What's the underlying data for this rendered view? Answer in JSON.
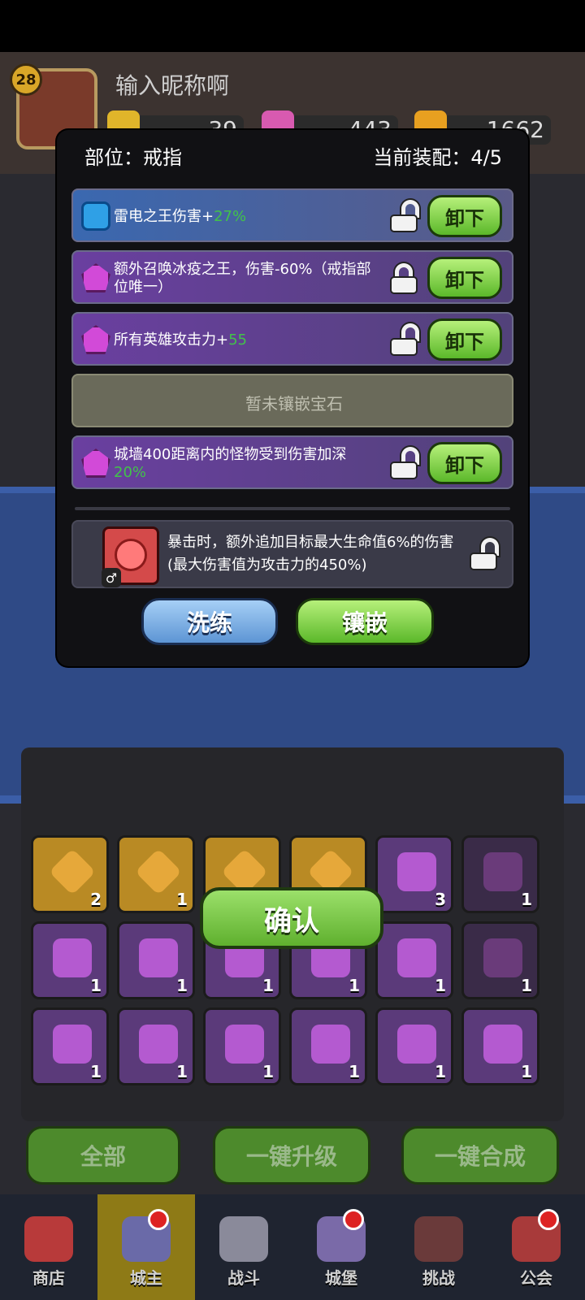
{
  "player": {
    "level": "28",
    "nickname": "输入昵称啊"
  },
  "resources": {
    "res1": "39",
    "res2": "443",
    "res3": "1662"
  },
  "panel": {
    "slot_label": "部位：戒指",
    "equip_label": "当前装配：4/5",
    "rows": [
      {
        "text_main": "雷电之王伤害+",
        "text_hl": "27%",
        "text_after": "",
        "gem": "blue-hex-gem-icon",
        "lock": "unlocked",
        "button": "卸下"
      },
      {
        "text_main": "额外召唤冰疫之王，伤害-60%（戒指部位唯一）",
        "text_hl": "",
        "text_after": "",
        "gem": "purple-pentagon-gem-icon",
        "lock": "locked",
        "button": "卸下"
      },
      {
        "text_main": "所有英雄攻击力+",
        "text_hl": "55",
        "text_after": "",
        "gem": "purple-pentagon-gem-icon",
        "lock": "unlocked",
        "button": "卸下"
      },
      {
        "empty_text": "暂未镶嵌宝石"
      },
      {
        "text_main": "城墙400距离内的怪物受到伤害加深",
        "text_hl": "20%",
        "text_after": "",
        "gem": "purple-pentagon-gem-icon",
        "lock": "unlocked",
        "button": "卸下"
      }
    ],
    "selected_gem": {
      "description": "暴击时，额外追加目标最大生命值6%的伤害(最大伤害值为攻击力的450%)",
      "card_color": "#d44a4a"
    },
    "wash_label": "洗练",
    "inlay_label": "镶嵌"
  },
  "confirm_label": "确认",
  "inventory_counts": [
    [
      "2",
      "1",
      "",
      "",
      "3",
      "1"
    ],
    [
      "1",
      "1",
      "1",
      "1",
      "1",
      "1"
    ],
    [
      "1",
      "1",
      "1",
      "1",
      "1",
      "1"
    ]
  ],
  "bottom_buttons": {
    "all": "全部",
    "upgrade": "一键升级",
    "merge": "一键合成"
  },
  "tabs": [
    {
      "label": "商店",
      "icon": "shop-icon",
      "active": false,
      "dot": false
    },
    {
      "label": "城主",
      "icon": "lord-icon",
      "active": true,
      "dot": true
    },
    {
      "label": "战斗",
      "icon": "swords-icon",
      "active": false,
      "dot": false
    },
    {
      "label": "城堡",
      "icon": "castle-icon",
      "active": false,
      "dot": true
    },
    {
      "label": "挑战",
      "icon": "challenge-icon",
      "active": false,
      "dot": false
    },
    {
      "label": "公会",
      "icon": "guild-icon",
      "active": false,
      "dot": true
    }
  ],
  "colors": {
    "accent_green": "#42c24a",
    "button_green": "#5bb82a",
    "button_blue": "#5d95d4",
    "active_tab": "#8e7a16"
  }
}
